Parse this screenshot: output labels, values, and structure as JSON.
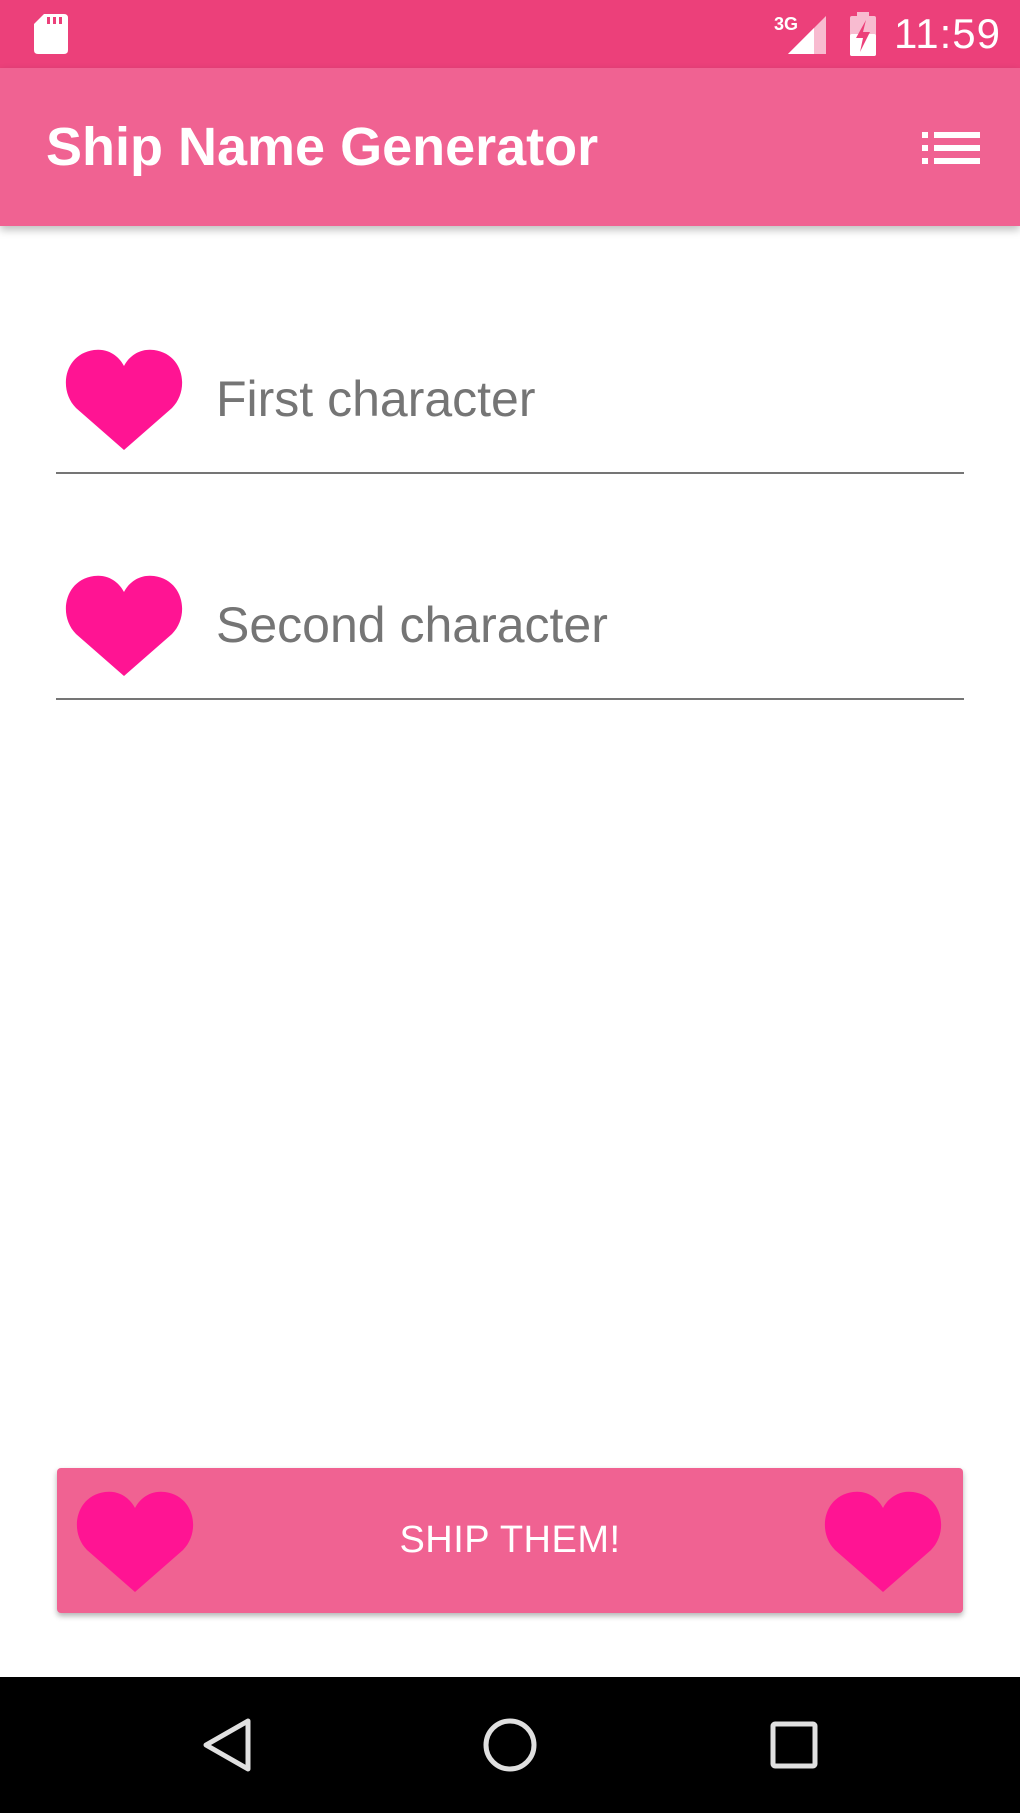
{
  "status_bar": {
    "network": "3G",
    "time": "11:59",
    "icons": [
      "sd-card-icon",
      "signal-3g-icon",
      "battery-charging-icon"
    ]
  },
  "app_bar": {
    "title": "Ship Name Generator",
    "menu_icon": "list-icon"
  },
  "form": {
    "first_character": {
      "placeholder": "First character",
      "value": "",
      "icon": "heart-icon"
    },
    "second_character": {
      "placeholder": "Second character",
      "value": "",
      "icon": "heart-icon"
    }
  },
  "ship_button": {
    "label": "SHIP THEM!",
    "icons": [
      "heart-icon",
      "heart-icon"
    ]
  },
  "nav_bar": {
    "icons": [
      "back-icon",
      "home-icon",
      "recents-icon"
    ]
  },
  "colors": {
    "status_bar": "#ec407a",
    "app_bar": "#f06292",
    "heart": "#ff1493",
    "button": "#f06292",
    "nav_bar": "#000000"
  }
}
